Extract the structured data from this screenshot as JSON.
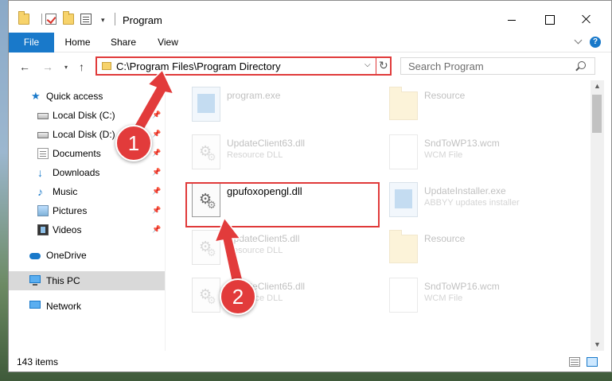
{
  "window": {
    "title": "Program",
    "quick_access_dropdown": "▾",
    "controls": {
      "minimize": "",
      "maximize": "",
      "close": ""
    }
  },
  "ribbon": {
    "tabs": [
      {
        "label": "File"
      },
      {
        "label": "Home"
      },
      {
        "label": "Share"
      },
      {
        "label": "View"
      }
    ],
    "help": "?"
  },
  "navbar": {
    "back": "←",
    "forward": "→",
    "recent": "▾",
    "up": "↑",
    "address": "C:\\Program Files\\Program Directory",
    "address_chevron": "⌵",
    "refresh": "↻",
    "search_placeholder": "Search Program"
  },
  "sidebar": {
    "items": [
      {
        "label": "Quick access",
        "icon": "star-icon"
      },
      {
        "label": "Local Disk (C:)",
        "icon": "drive-icon",
        "pinned": true
      },
      {
        "label": "Local Disk (D:)",
        "icon": "drive-icon",
        "pinned": true
      },
      {
        "label": "Documents",
        "icon": "documents-icon",
        "pinned": true
      },
      {
        "label": "Downloads",
        "icon": "download-icon",
        "pinned": true
      },
      {
        "label": "Music",
        "icon": "music-icon",
        "pinned": true
      },
      {
        "label": "Pictures",
        "icon": "pictures-icon",
        "pinned": true
      },
      {
        "label": "Videos",
        "icon": "videos-icon",
        "pinned": true
      },
      {
        "label": "OneDrive",
        "icon": "cloud-icon"
      },
      {
        "label": "This PC",
        "icon": "computer-icon"
      },
      {
        "label": "Network",
        "icon": "network-icon"
      }
    ],
    "pin_glyph": "📌"
  },
  "files": [
    {
      "name": "program.exe",
      "type": "",
      "icon": "exe-icon"
    },
    {
      "name": "Resource",
      "type": "",
      "icon": "folder-icon"
    },
    {
      "name": "UpdateClient63.dll",
      "type": "Resource DLL",
      "icon": "dll-icon"
    },
    {
      "name": "SndToWP13.wcm",
      "type": "WCM File",
      "icon": "wcm-icon"
    },
    {
      "name": "gpufoxopengl.dll",
      "type": "",
      "icon": "dll-icon",
      "highlighted": true
    },
    {
      "name": "UpdateInstaller.exe",
      "type": "ABBYY updates installer",
      "icon": "exe-icon"
    },
    {
      "name": "UpdateClient5.dll",
      "type": "Resource DLL",
      "icon": "dll-icon"
    },
    {
      "name": "Resource",
      "type": "",
      "icon": "folder-icon"
    },
    {
      "name": "UpdateClient65.dll",
      "type": "Resource DLL",
      "icon": "dll-icon"
    },
    {
      "name": "SndToWP16.wcm",
      "type": "WCM File",
      "icon": "wcm-icon"
    }
  ],
  "scrollbar": {
    "up": "▲",
    "down": "▼"
  },
  "status": {
    "item_count": "143 items"
  },
  "annotations": {
    "step1": "1",
    "step2": "2"
  },
  "colors": {
    "accent": "#1979ca",
    "annotation": "#e23b3b",
    "folder": "#f7d36b"
  }
}
